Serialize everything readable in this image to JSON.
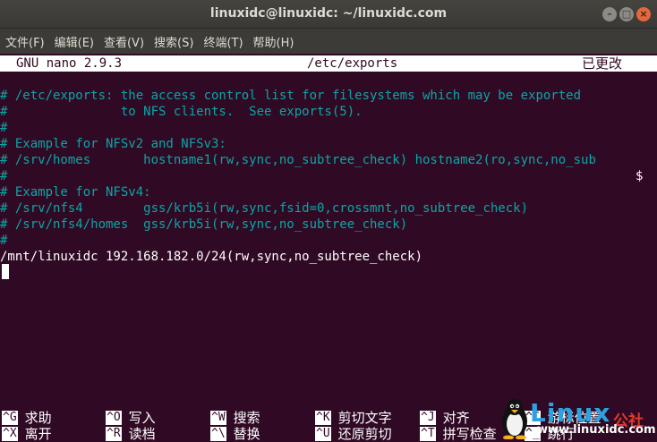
{
  "window": {
    "title": "linuxidc@linuxidc: ~/linuxidc.com",
    "controls": {
      "minimize": "–",
      "maximize": "□",
      "close": "×"
    }
  },
  "menu": [
    "文件(F)",
    "编辑(E)",
    "查看(V)",
    "搜索(S)",
    "终端(T)",
    "帮助(H)"
  ],
  "nano": {
    "version": "GNU nano 2.9.3",
    "filename": "/etc/exports",
    "status": "已更改"
  },
  "lines": [
    {
      "text": "",
      "kind": "plain"
    },
    {
      "text": "# /etc/exports: the access control list for filesystems which may be exported",
      "kind": "comment"
    },
    {
      "text": "#               to NFS clients.  See exports(5).",
      "kind": "comment"
    },
    {
      "text": "#",
      "kind": "comment"
    },
    {
      "text": "# Example for NFSv2 and NFSv3:",
      "kind": "comment"
    },
    {
      "text": "# /srv/homes       hostname1(rw,sync,no_subtree_check) hostname2(ro,sync,no_sub",
      "kind": "comment"
    },
    {
      "text": "#",
      "kind": "comment"
    },
    {
      "text": "# Example for NFSv4:",
      "kind": "comment"
    },
    {
      "text": "# /srv/nfs4        gss/krb5i(rw,sync,fsid=0,crossmnt,no_subtree_check)",
      "kind": "comment"
    },
    {
      "text": "# /srv/nfs4/homes  gss/krb5i(rw,sync,no_subtree_check)",
      "kind": "comment"
    },
    {
      "text": "#",
      "kind": "comment"
    },
    {
      "text": "/mnt/linuxidc 192.168.182.0/24(rw,sync,no_subtree_check)",
      "kind": "plain"
    }
  ],
  "overflow_marker": "$",
  "shortcuts": [
    {
      "key": "^G",
      "label": "求助"
    },
    {
      "key": "^O",
      "label": "写入"
    },
    {
      "key": "^W",
      "label": "搜索"
    },
    {
      "key": "^K",
      "label": "剪切文字"
    },
    {
      "key": "^J",
      "label": "对齐"
    },
    {
      "key": "^C",
      "label": "游标位置"
    },
    {
      "key": "^X",
      "label": "离开"
    },
    {
      "key": "^R",
      "label": "读档"
    },
    {
      "key": "^\\",
      "label": "替换"
    },
    {
      "key": "^U",
      "label": "还原剪切"
    },
    {
      "key": "^T",
      "label": "拼写检查"
    },
    {
      "key": "^_",
      "label": "跳行"
    }
  ],
  "watermark": {
    "brand": "Linux",
    "cn": "公社",
    "url": "www.linuxidc.com"
  },
  "colors": {
    "terminal_bg": "#300a24",
    "comment": "#0aa6a6",
    "text": "#ffffff"
  }
}
